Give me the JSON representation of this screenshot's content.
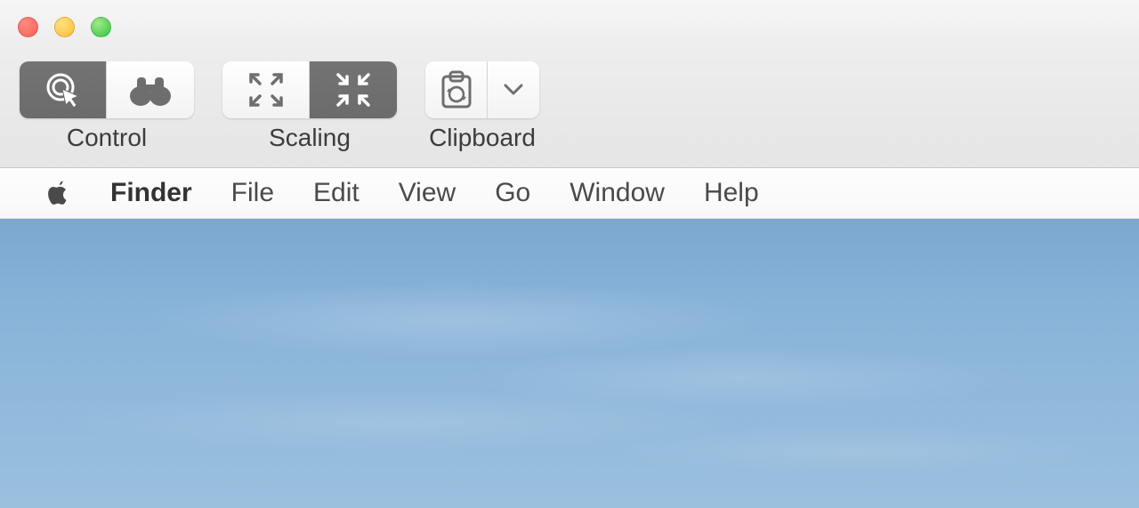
{
  "traffic_lights": {
    "close": "close",
    "minimize": "minimize",
    "zoom": "zoom"
  },
  "toolbar": {
    "groups": [
      {
        "name": "control",
        "label": "Control",
        "buttons": [
          {
            "name": "control-cursor-button",
            "icon": "cursor-target-icon",
            "active": true
          },
          {
            "name": "control-observe-button",
            "icon": "binoculars-icon",
            "active": false
          }
        ]
      },
      {
        "name": "scaling",
        "label": "Scaling",
        "buttons": [
          {
            "name": "scaling-fit-button",
            "icon": "expand-arrows-icon",
            "active": false
          },
          {
            "name": "scaling-actual-button",
            "icon": "contract-arrows-icon",
            "active": true
          }
        ]
      },
      {
        "name": "clipboard",
        "label": "Clipboard",
        "buttons": [
          {
            "name": "clipboard-sync-button",
            "icon": "clipboard-sync-icon",
            "active": false
          },
          {
            "name": "clipboard-menu-button",
            "icon": "chevron-down-icon",
            "active": false
          }
        ]
      }
    ]
  },
  "menubar": {
    "active_app": "Finder",
    "items": [
      "File",
      "Edit",
      "View",
      "Go",
      "Window",
      "Help"
    ]
  }
}
